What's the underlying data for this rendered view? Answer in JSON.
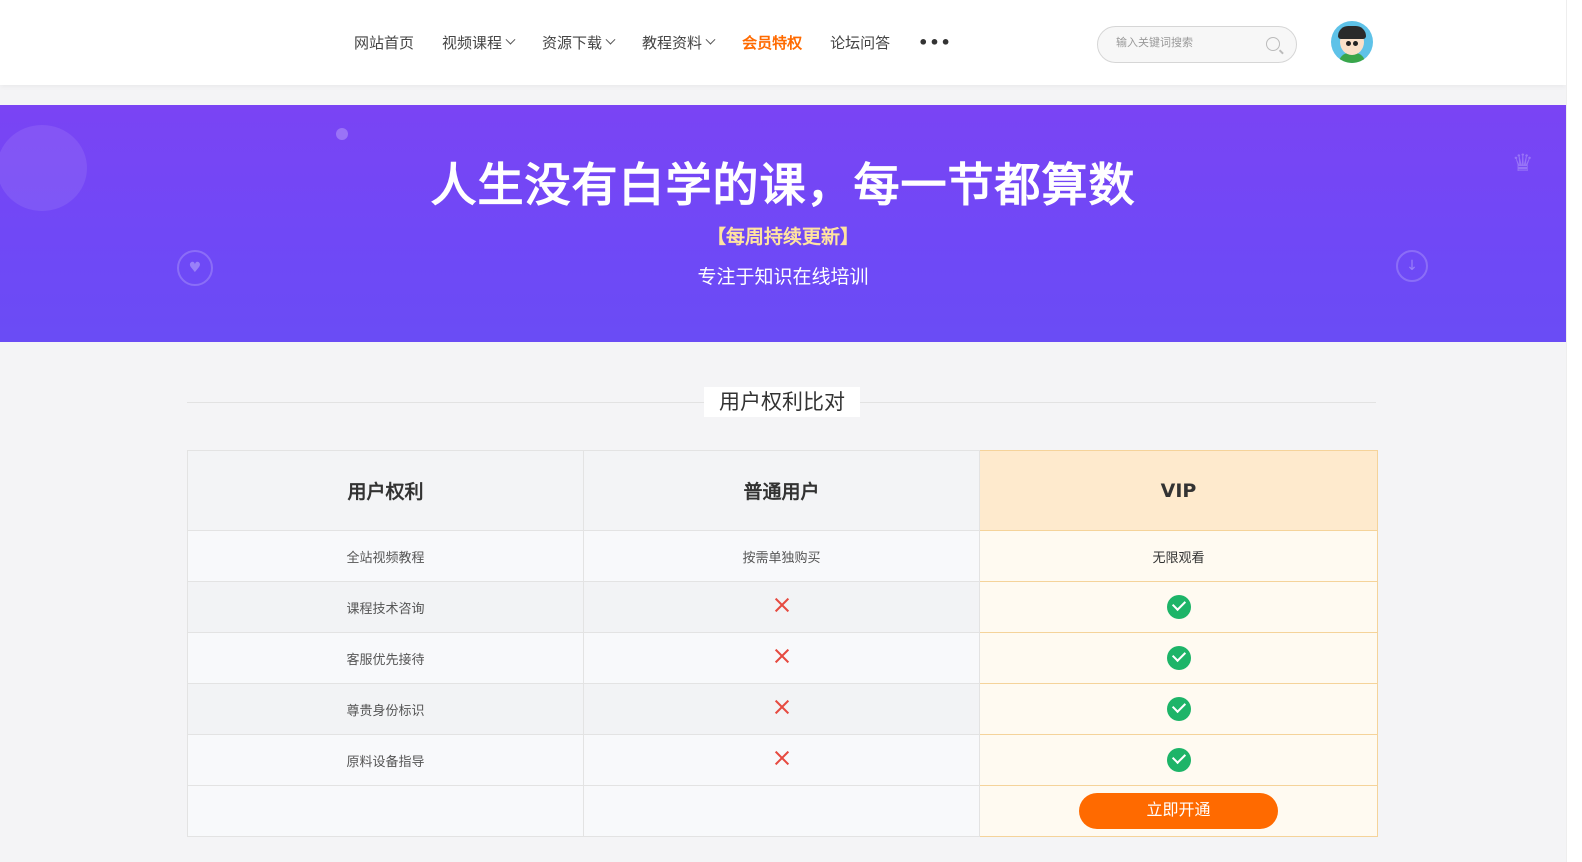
{
  "nav": {
    "items": [
      {
        "label": "网站首页",
        "dropdown": false,
        "active": false
      },
      {
        "label": "视频课程",
        "dropdown": true,
        "active": false
      },
      {
        "label": "资源下载",
        "dropdown": true,
        "active": false
      },
      {
        "label": "教程资料",
        "dropdown": true,
        "active": false
      },
      {
        "label": "会员特权",
        "dropdown": false,
        "active": true
      },
      {
        "label": "论坛问答",
        "dropdown": false,
        "active": false
      }
    ],
    "more_label": "•••"
  },
  "search": {
    "placeholder": "输入关键词搜索",
    "icon": "search-icon"
  },
  "banner": {
    "title": "人生没有白学的课，每一节都算数",
    "tag": "【每周持续更新】",
    "subtitle": "专注于知识在线培训"
  },
  "section": {
    "title": "用户权利比对"
  },
  "table": {
    "headers": [
      "用户权利",
      "普通用户",
      "VIP"
    ],
    "rows": [
      {
        "right": "全站视频教程",
        "normal": "按需单独购买",
        "vip": "无限观看",
        "normal_type": "text",
        "vip_type": "text"
      },
      {
        "right": "课程技术咨询",
        "normal": "",
        "vip": "",
        "normal_type": "cross",
        "vip_type": "check"
      },
      {
        "right": "客服优先接待",
        "normal": "",
        "vip": "",
        "normal_type": "cross",
        "vip_type": "check"
      },
      {
        "right": "尊贵身份标识",
        "normal": "",
        "vip": "",
        "normal_type": "cross",
        "vip_type": "check"
      },
      {
        "right": "原料设备指导",
        "normal": "",
        "vip": "",
        "normal_type": "cross",
        "vip_type": "check"
      }
    ],
    "action_label": "立即开通"
  },
  "colors": {
    "accent": "#ff6a00",
    "banner": "#7a44f4",
    "check": "#1db468",
    "cross": "#e64a40",
    "vip_header": "#feeacd"
  }
}
